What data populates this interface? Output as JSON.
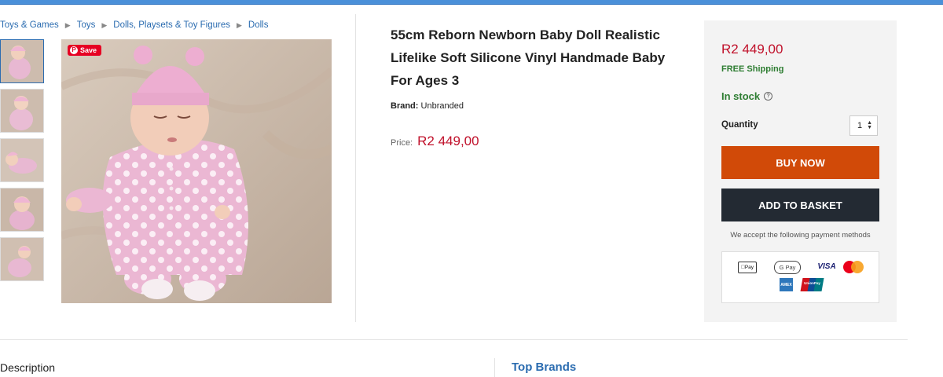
{
  "breadcrumb": [
    "Toys & Games",
    "Toys",
    "Dolls, Playsets & Toy Figures",
    "Dolls"
  ],
  "gallery": {
    "thumbnail_count": 5,
    "active_thumbnail": 0,
    "save_label": "Save"
  },
  "product": {
    "title": "55cm Reborn Newborn Baby Doll Realistic Lifelike Soft Silicone Vinyl Handmade Baby For Ages 3",
    "brand_label": "Brand:",
    "brand_value": "Unbranded",
    "price_label": "Price:",
    "price": "R2 449,00"
  },
  "buybox": {
    "price": "R2 449,00",
    "shipping": "FREE Shipping",
    "stock": "In stock",
    "quantity_label": "Quantity",
    "quantity_value": "1",
    "buy_now": "BUY NOW",
    "add_to_basket": "ADD TO BASKET",
    "payment_note": "We accept the following payment methods",
    "payment_methods": {
      "apple_pay": "Pay",
      "google_pay": "G Pay",
      "visa": "VISA",
      "amex": "AMEX",
      "unionpay": "UnionPay"
    }
  },
  "sections": {
    "description": "Description",
    "top_brands": "Top Brands"
  },
  "colors": {
    "accent_link": "#2b6cb0",
    "price_red": "#c0102a",
    "stock_green": "#2e7d32",
    "buy_now_bg": "#d14a08",
    "basket_bg": "#232a33",
    "pinterest_red": "#e60023"
  }
}
